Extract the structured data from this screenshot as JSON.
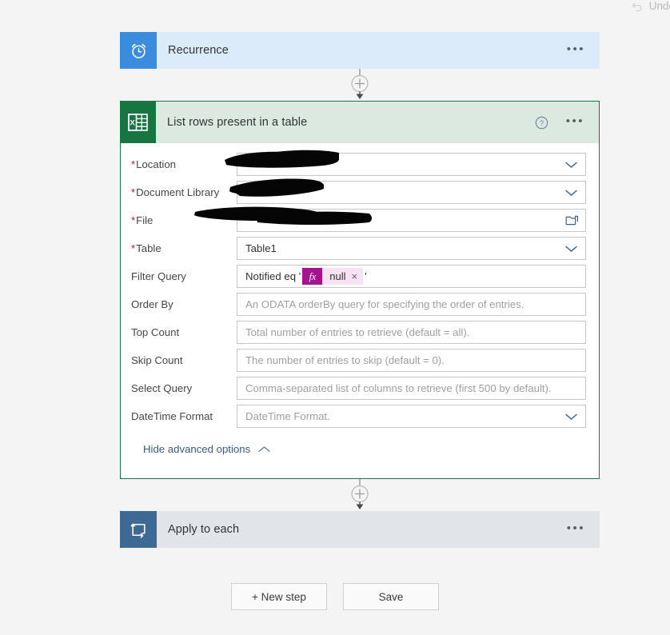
{
  "topbar": {
    "undo_label": "Undo",
    "undo_icon": "undo-arrow-icon"
  },
  "flow": {
    "trigger": {
      "title": "Recurrence",
      "icon": "alarm-clock-icon",
      "icon_bg": "#3a8dde",
      "header_bg": "#dcebfa",
      "menu_label": "•••"
    },
    "action_excel": {
      "title": "List rows present in a table",
      "icon": "excel-table-icon",
      "icon_bg": "#177541",
      "header_bg": "#dbe9e1",
      "border_color": "#107c41",
      "help_label": "?",
      "menu_label": "•••",
      "fields": [
        {
          "label": "Location",
          "required": true,
          "value": "",
          "placeholder": "",
          "trailing_icon": "chevron-down-icon",
          "redacted": true,
          "name": "location"
        },
        {
          "label": "Document Library",
          "required": true,
          "value": "",
          "placeholder": "",
          "trailing_icon": "chevron-down-icon",
          "redacted": true,
          "name": "document-library"
        },
        {
          "label": "File",
          "required": true,
          "value": "",
          "placeholder": "",
          "trailing_icon": "folder-icon",
          "redacted": true,
          "name": "file"
        },
        {
          "label": "Table",
          "required": true,
          "value": "Table1",
          "placeholder": "",
          "trailing_icon": "chevron-down-icon",
          "redacted": false,
          "name": "table"
        }
      ],
      "filter_query": {
        "label": "Filter Query",
        "prefix": "Notified eq '",
        "token_fx": "fx",
        "token_text": "null",
        "token_remove": "×",
        "suffix": "'"
      },
      "advanced_fields": [
        {
          "label": "Order By",
          "value": "",
          "placeholder": "An ODATA orderBy query for specifying the order of entries.",
          "name": "order-by"
        },
        {
          "label": "Top Count",
          "value": "",
          "placeholder": "Total number of entries to retrieve (default = all).",
          "name": "top-count"
        },
        {
          "label": "Skip Count",
          "value": "",
          "placeholder": "The number of entries to skip (default = 0).",
          "name": "skip-count"
        },
        {
          "label": "Select Query",
          "value": "",
          "placeholder": "Comma-separated list of columns to retrieve (first 500 by default).",
          "name": "select-query"
        }
      ],
      "datetime_format": {
        "label": "DateTime Format",
        "value": "",
        "placeholder": "DateTime Format.",
        "trailing_icon": "chevron-down-icon"
      },
      "advanced_toggle": {
        "label": "Hide advanced options",
        "icon": "chevron-up-icon"
      }
    },
    "action_loop": {
      "title": "Apply to each",
      "icon": "loop-repeat-icon",
      "icon_bg": "#3d6a94",
      "header_bg": "#e1e5e9",
      "menu_label": "•••"
    },
    "connectors": [
      {
        "icon": "add-step-plus-icon",
        "name": "connector-trigger-to-excel"
      },
      {
        "icon": "add-step-plus-icon",
        "name": "connector-excel-to-loop"
      }
    ]
  },
  "footer": {
    "new_step_label": "+ New step",
    "save_label": "Save"
  },
  "colors": {
    "page_bg": "#f4f4f4",
    "excel_green": "#107c41",
    "trigger_blue": "#3a8dde",
    "token_magenta": "#a4148c",
    "token_bg": "#f7e2f3",
    "required_red": "#a4262c",
    "link_blue": "#3a5a7d"
  }
}
